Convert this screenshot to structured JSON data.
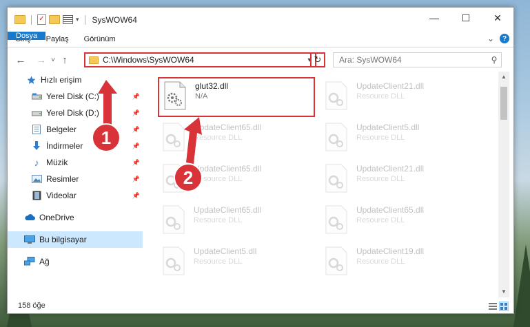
{
  "window": {
    "title": "SysWOW64",
    "controls": {
      "minimize": "—",
      "maximize": "☐",
      "close": "✕"
    }
  },
  "ribbon": {
    "tabs": [
      "Dosya",
      "Giriş",
      "Paylaş",
      "Görünüm"
    ],
    "expand_glyph": "⌄",
    "help_glyph": "?"
  },
  "nav": {
    "back": "←",
    "forward": "→",
    "history": "˅",
    "up": "↑",
    "address": "C:\\Windows\\SysWOW64",
    "refresh": "↻",
    "search_placeholder": "Ara: SysWOW64"
  },
  "sidebar": {
    "quick_access": "Hızlı erişim",
    "items": [
      {
        "label": "Yerel Disk (C:)",
        "icon": "drive-c-icon",
        "pinned": true
      },
      {
        "label": "Yerel Disk (D:)",
        "icon": "drive-d-icon",
        "pinned": true
      },
      {
        "label": "Belgeler",
        "icon": "documents-icon",
        "pinned": true
      },
      {
        "label": "İndirmeler",
        "icon": "downloads-icon",
        "pinned": true
      },
      {
        "label": "Müzik",
        "icon": "music-icon",
        "pinned": true
      },
      {
        "label": "Resimler",
        "icon": "pictures-icon",
        "pinned": true
      },
      {
        "label": "Videolar",
        "icon": "videos-icon",
        "pinned": true
      }
    ],
    "onedrive": "OneDrive",
    "this_pc": "Bu bilgisayar",
    "network": "Ağ"
  },
  "files": [
    {
      "name": "glut32.dll",
      "type": "N/A",
      "highlighted": true
    },
    {
      "name": "UpdateClient21.dll",
      "type": "Resource DLL"
    },
    {
      "name": "UpdateClient65.dll",
      "type": "Resource DLL"
    },
    {
      "name": "UpdateClient5.dll",
      "type": "Resource DLL"
    },
    {
      "name": "UpdateClient65.dll",
      "type": "Resource DLL"
    },
    {
      "name": "UpdateClient21.dll",
      "type": "Resource DLL"
    },
    {
      "name": "UpdateClient65.dll",
      "type": "Resource DLL"
    },
    {
      "name": "UpdateClient65.dll",
      "type": "Resource DLL"
    },
    {
      "name": "UpdateClient5.dll",
      "type": "Resource DLL"
    },
    {
      "name": "UpdateClient19.dll",
      "type": "Resource DLL"
    }
  ],
  "status": {
    "count": "158 öğe"
  },
  "annotations": {
    "step1": "1",
    "step2": "2",
    "color": "#d9333a"
  },
  "colors": {
    "accent": "#1979ca",
    "selection": "#cce8ff",
    "highlight": "#d9333a"
  }
}
